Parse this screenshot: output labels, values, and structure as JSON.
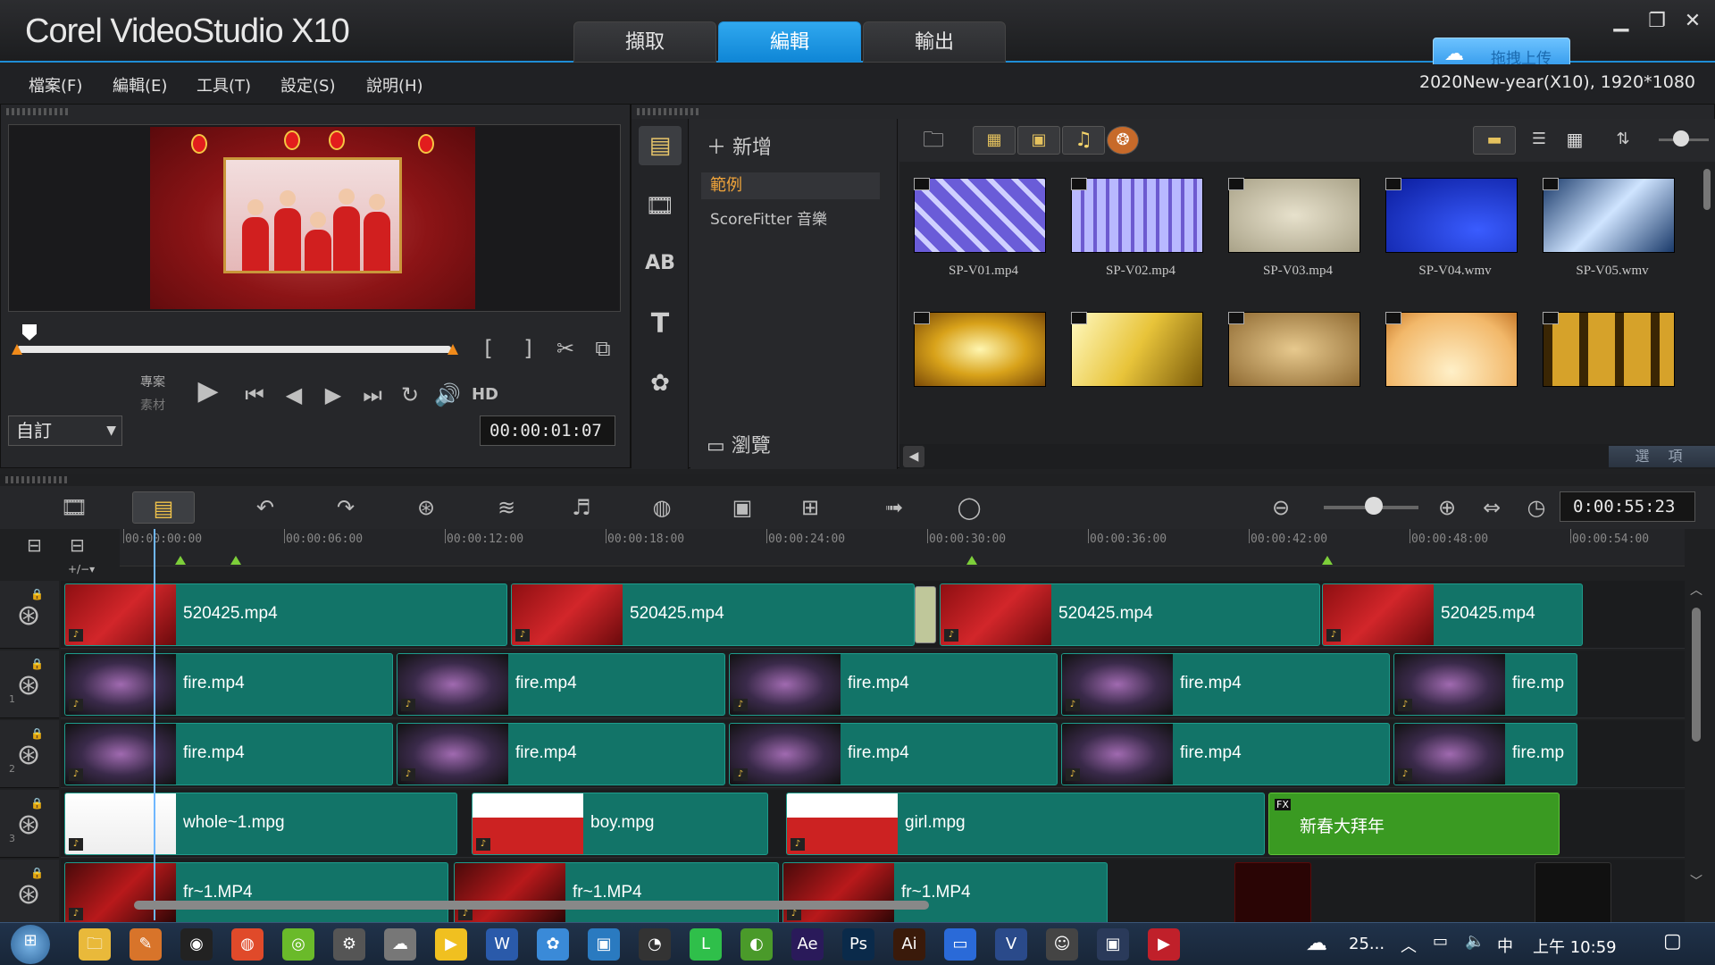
{
  "app": {
    "title": "Corel VideoStudio X10",
    "project_info": "2020New-year(X10), 1920*1080",
    "main_tabs": [
      {
        "label": "擷取"
      },
      {
        "label": "編輯"
      },
      {
        "label": "輸出"
      }
    ],
    "cloud_upload_label": "拖拽上传",
    "accent_color": "#1f8dd6"
  },
  "menu": [
    {
      "label": "檔案(F)"
    },
    {
      "label": "編輯(E)"
    },
    {
      "label": "工具(T)"
    },
    {
      "label": "設定(S)"
    },
    {
      "label": "說明(H)"
    }
  ],
  "player": {
    "mode_project": "專案",
    "mode_clip": "素材",
    "hd_label": "HD",
    "size_select": "自訂",
    "timecode": "00:00:01:07",
    "mark_in": "[",
    "mark_out": "]"
  },
  "library": {
    "add_label": "新增",
    "folders": [
      {
        "label": "範例"
      },
      {
        "label": "ScoreFitter 音樂"
      }
    ],
    "browse_label": "瀏覽",
    "options_label": "選 項",
    "items": [
      {
        "name": "SP-V01.mp4",
        "style": "purple-tiles"
      },
      {
        "name": "SP-V02.mp4",
        "style": "purple-grid"
      },
      {
        "name": "SP-V03.mp4",
        "style": "beige"
      },
      {
        "name": "SP-V04.wmv",
        "style": "blue"
      },
      {
        "name": "SP-V05.wmv",
        "style": "silver-blue"
      },
      {
        "name": "",
        "style": "gold-bokeh"
      },
      {
        "name": "",
        "style": "gold-rays"
      },
      {
        "name": "",
        "style": "parchment"
      },
      {
        "name": "",
        "style": "peach"
      },
      {
        "name": "",
        "style": "filmstrip"
      }
    ]
  },
  "timeline": {
    "total_time": "0:00:55:23",
    "ruler_labels": [
      "00:00:00:00",
      "00:00:06:00",
      "00:00:12:00",
      "00:00:18:00",
      "00:00:24:00",
      "00:00:30:00",
      "00:00:36:00",
      "00:00:42:00",
      "00:00:48:00",
      "00:00:54:00"
    ],
    "tracks": [
      {
        "name": "video-track",
        "clips": [
          {
            "name": "520425.mp4"
          },
          {
            "name": "520425.mp4"
          },
          {
            "name": "520425.mp4"
          },
          {
            "name": "520425.mp4"
          }
        ]
      },
      {
        "name": "overlay-track-1",
        "number": "1",
        "clips": [
          {
            "name": "fire.mp4"
          },
          {
            "name": "fire.mp4"
          },
          {
            "name": "fire.mp4"
          },
          {
            "name": "fire.mp4"
          },
          {
            "name": "fire.mp"
          }
        ]
      },
      {
        "name": "overlay-track-2",
        "number": "2",
        "clips": [
          {
            "name": "fire.mp4"
          },
          {
            "name": "fire.mp4"
          },
          {
            "name": "fire.mp4"
          },
          {
            "name": "fire.mp4"
          },
          {
            "name": "fire.mp"
          }
        ]
      },
      {
        "name": "overlay-track-3",
        "number": "3",
        "clips": [
          {
            "name": "whole~1.mpg"
          },
          {
            "name": "boy.mpg"
          },
          {
            "name": "girl.mpg"
          },
          {
            "name": "新春大拜年"
          }
        ]
      },
      {
        "name": "overlay-track-4",
        "clips": [
          {
            "name": "fr~1.MP4"
          },
          {
            "name": "fr~1.MP4"
          },
          {
            "name": "fr~1.MP4"
          }
        ]
      }
    ]
  },
  "taskbar": {
    "weather": "25...",
    "ime": "中",
    "clock": "上午 10:59"
  }
}
